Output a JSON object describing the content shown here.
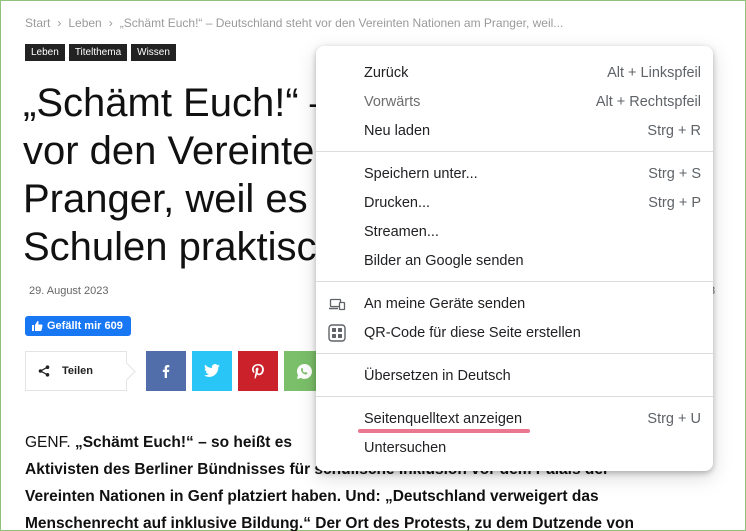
{
  "breadcrumb": {
    "items": [
      "Start",
      "Leben",
      "„Schämt Euch!“ – Deutschland steht vor den Vereinten Nationen am Pranger, weil..."
    ],
    "separator": "›"
  },
  "tags": [
    "Leben",
    "Titelthema",
    "Wissen"
  ],
  "headline": {
    "lines": [
      "„Schämt Euch!“ –",
      "vor den Vereinte",
      "Pranger, weil es",
      "Schulen praktisc"
    ]
  },
  "date": "29. August 2023",
  "date_right_fragment": "8",
  "facebook_like": {
    "label": "Gefällt mir 609",
    "icon": "thumbs-up-icon"
  },
  "share": {
    "label": "Teilen",
    "icon": "share-icon"
  },
  "social_buttons": [
    {
      "name": "facebook",
      "icon": "facebook-icon",
      "color": "#516eab"
    },
    {
      "name": "twitter",
      "icon": "twitter-icon",
      "color": "#29c5f6"
    },
    {
      "name": "pinterest",
      "icon": "pinterest-icon",
      "color": "#ca212a"
    },
    {
      "name": "whatsapp",
      "icon": "whatsapp-icon",
      "color": "#7bbf6a"
    }
  ],
  "article": {
    "line1_plain": "GENF. ",
    "line1_bold": "„Schämt Euch!“ – so heißt es",
    "line2": "Aktivisten des Berliner Bündnisses für schulische Inklusion vor dem Palais der",
    "line3": "Vereinten Nationen in Genf platziert haben. Und: „Deutschland verweigert das",
    "line4": "Menschenrecht auf inklusive Bildung.“ Der Ort des Protests, zu dem Dutzende von"
  },
  "context_menu": {
    "back": {
      "label": "Zurück",
      "shortcut": "Alt + Linkspfeil"
    },
    "forward": {
      "label": "Vorwärts",
      "shortcut": "Alt + Rechtspfeil"
    },
    "reload": {
      "label": "Neu laden",
      "shortcut": "Strg + R"
    },
    "save_as": {
      "label": "Speichern unter...",
      "shortcut": "Strg + S"
    },
    "print": {
      "label": "Drucken...",
      "shortcut": "Strg + P"
    },
    "cast": {
      "label": "Streamen..."
    },
    "google_images": {
      "label": "Bilder an Google senden"
    },
    "send_to_devices": {
      "label": "An meine Geräte senden",
      "icon": "devices-icon"
    },
    "qr_code": {
      "label": "QR-Code für diese Seite erstellen",
      "icon": "qr-code-icon"
    },
    "translate": {
      "label": "Übersetzen in Deutsch"
    },
    "view_source": {
      "label": "Seitenquelltext anzeigen",
      "shortcut": "Strg + U",
      "highlight_color": "#e8778f"
    },
    "inspect": {
      "label": "Untersuchen"
    }
  }
}
